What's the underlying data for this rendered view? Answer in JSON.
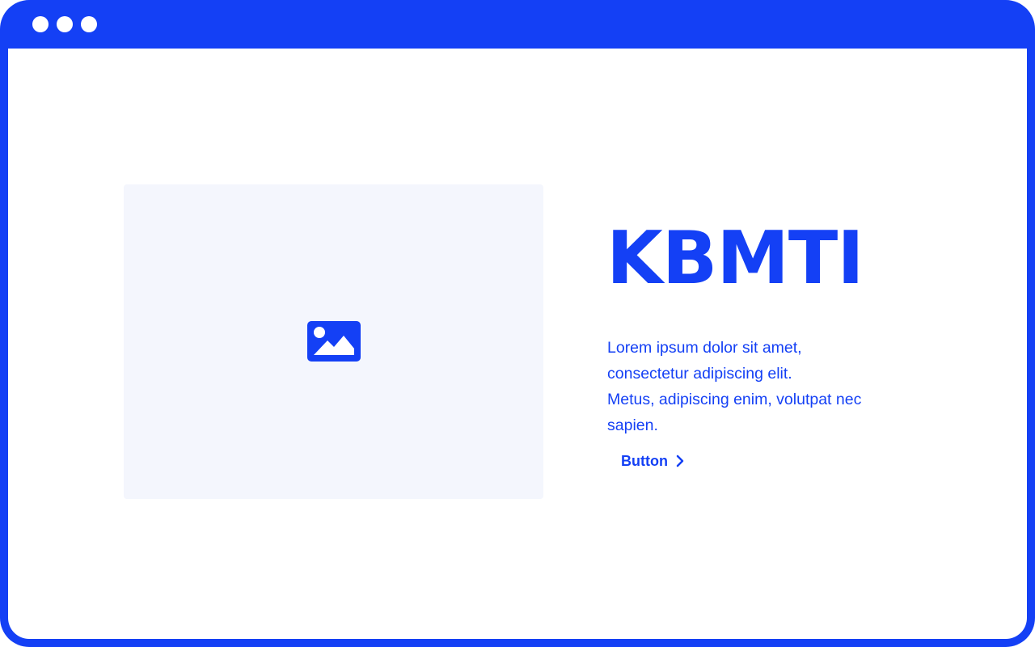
{
  "window": {
    "controls": [
      "dot",
      "dot",
      "dot"
    ]
  },
  "hero": {
    "image_icon": "image-icon",
    "title": "KBMTI",
    "description_lines": [
      "Lorem ipsum dolor sit amet,",
      "consectetur adipiscing elit.",
      "Metus, adipiscing enim, volutpat nec",
      "sapien."
    ],
    "button_label": "Button",
    "button_icon": "chevron-right-icon"
  },
  "colors": {
    "accent": "#1440F5",
    "placeholder_bg": "#F4F6FD",
    "background": "#FFFFFF"
  }
}
